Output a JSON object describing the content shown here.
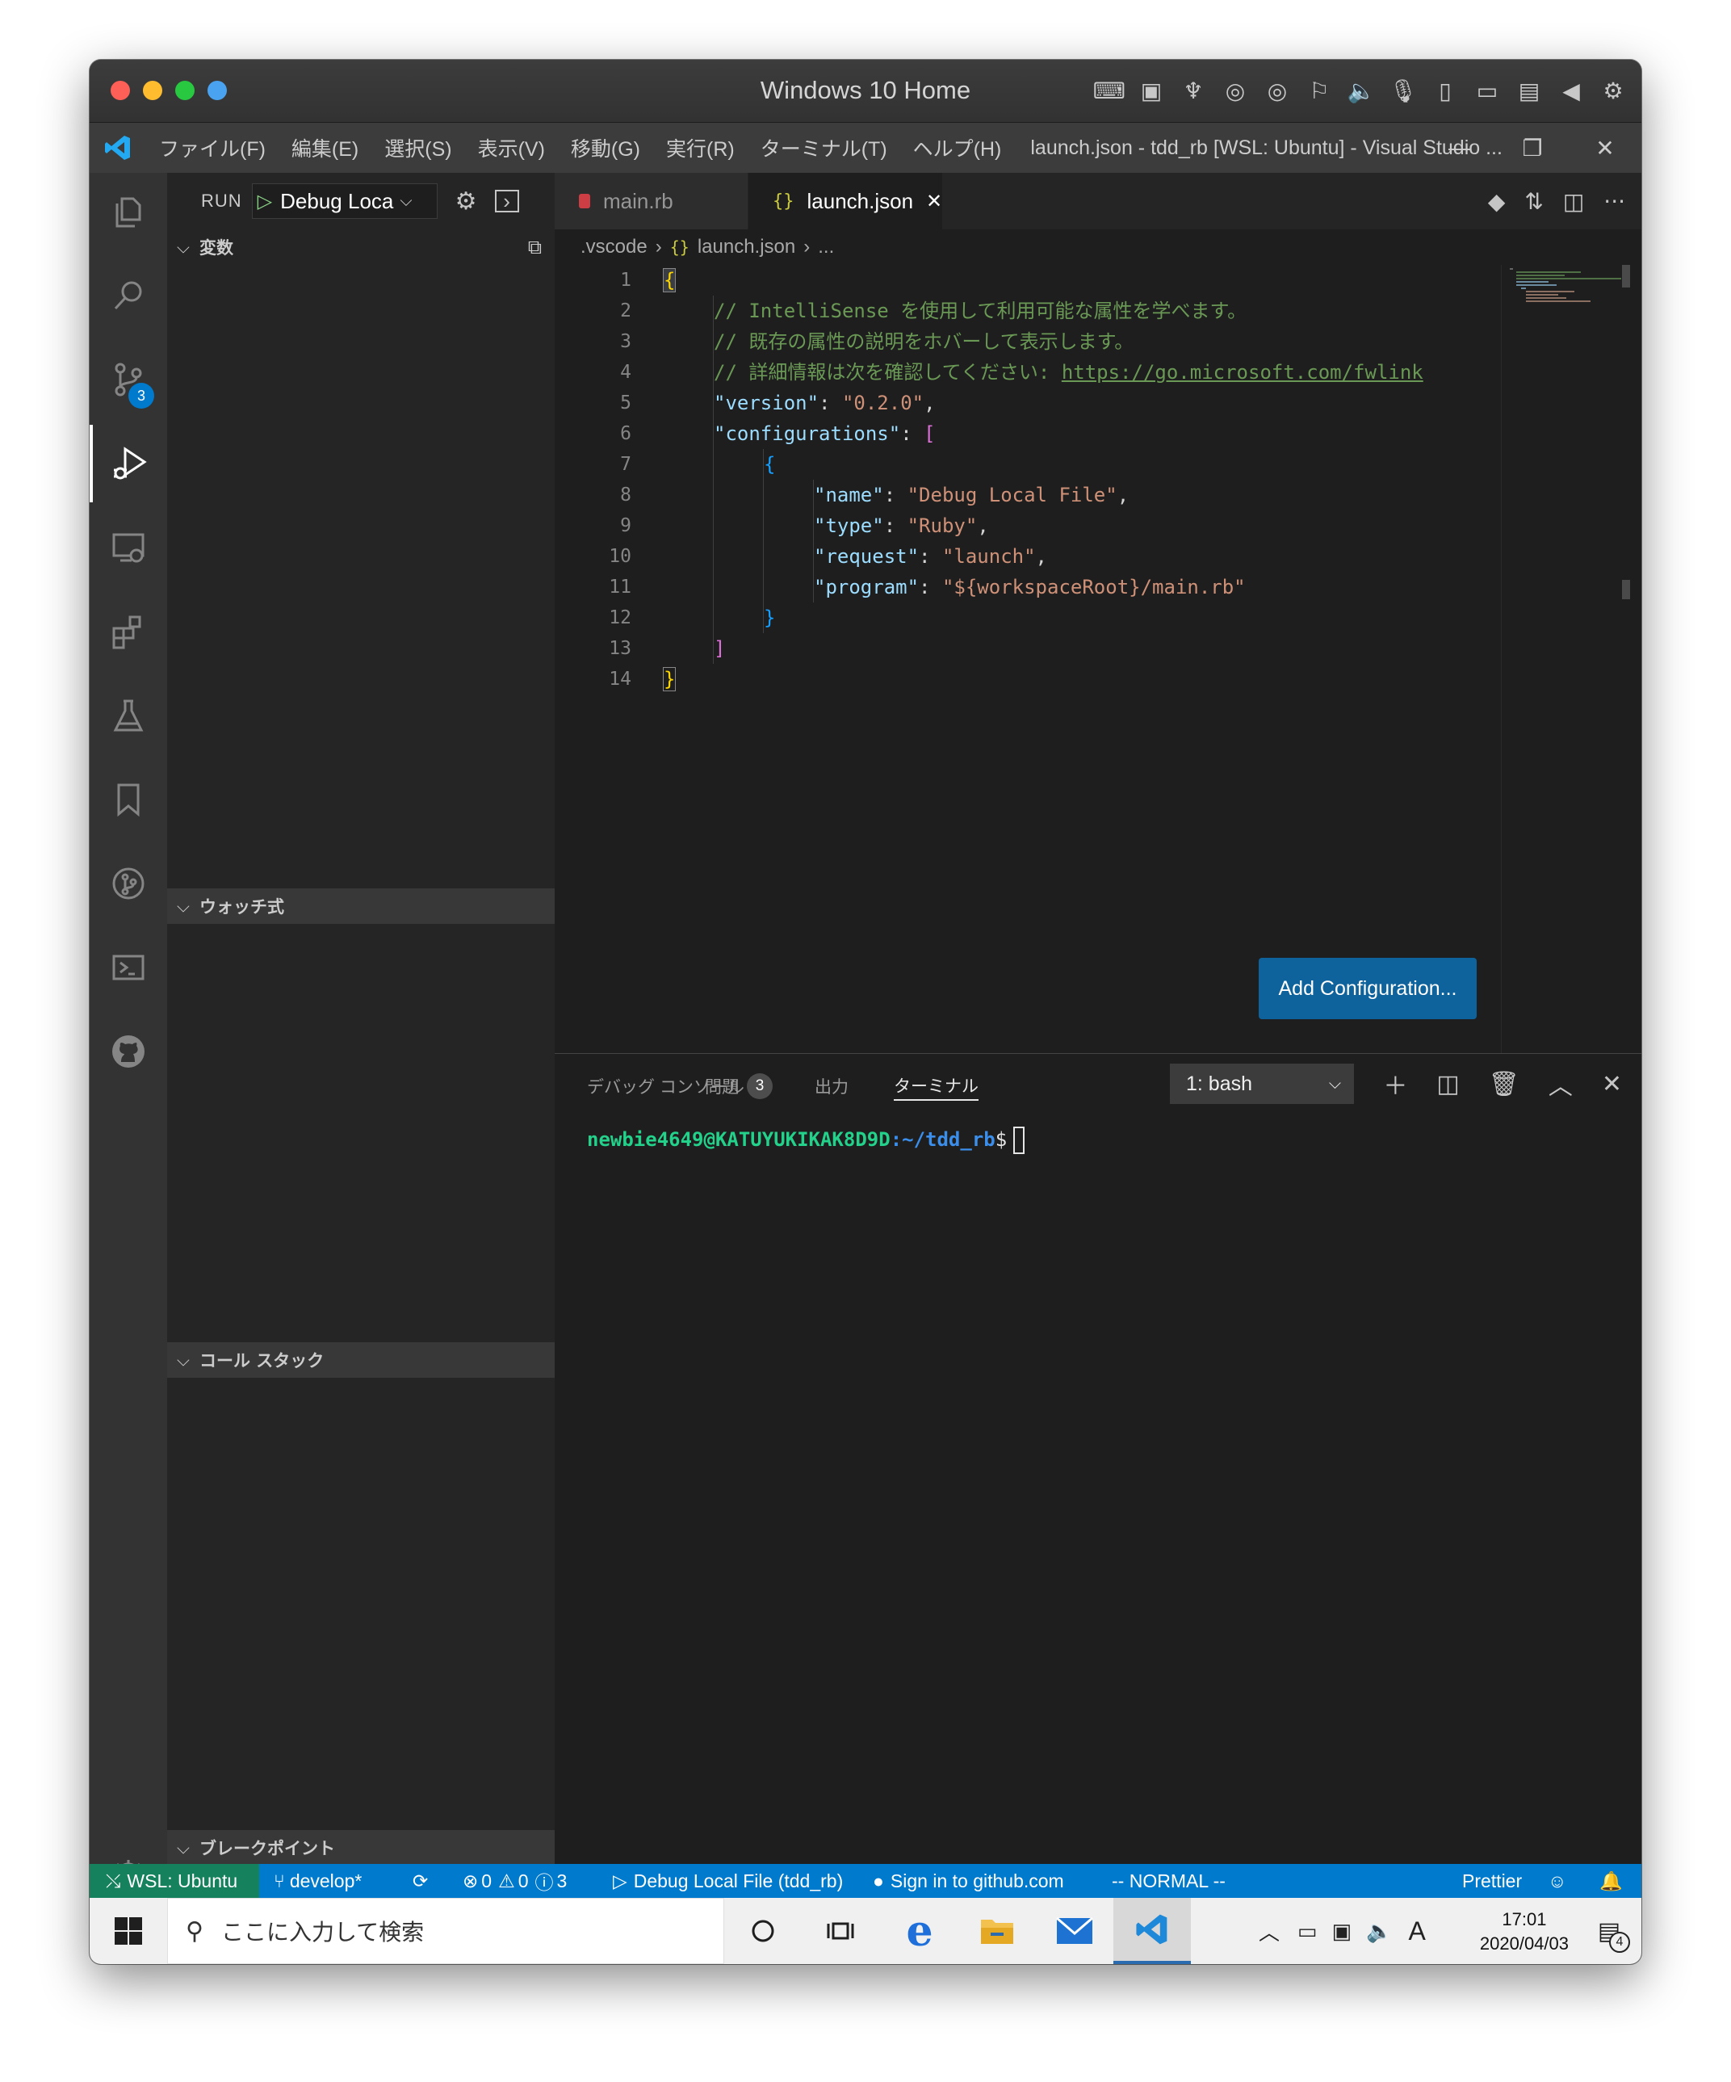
{
  "mac_window": {
    "title": "Windows 10 Home"
  },
  "vscode": {
    "menu": [
      "ファイル(F)",
      "編集(E)",
      "選択(S)",
      "表示(V)",
      "移動(G)",
      "実行(R)",
      "ターミナル(T)",
      "ヘルプ(H)"
    ],
    "window_title": "launch.json - tdd_rb [WSL: Ubuntu] - Visual Studio ...",
    "activity_badge": "3"
  },
  "sidebar": {
    "run_label": "RUN",
    "config_select": "Debug Loca",
    "sections": {
      "variables": "変数",
      "watch": "ウォッチ式",
      "callstack": "コール スタック",
      "breakpoints": "ブレークポイント"
    }
  },
  "tabs": [
    {
      "label": "main.rb"
    },
    {
      "label": "launch.json"
    }
  ],
  "breadcrumb": {
    "folder": ".vscode",
    "file": "launch.json",
    "more": "..."
  },
  "editor": {
    "line_numbers": [
      "1",
      "2",
      "3",
      "4",
      "5",
      "6",
      "7",
      "8",
      "9",
      "10",
      "11",
      "12",
      "13",
      "14"
    ],
    "comments": {
      "c1": "// IntelliSense を使用して利用可能な属性を学べます。",
      "c2": "// 既存の属性の説明をホバーして表示します。",
      "c3": "// 詳細情報は次を確認してください: ",
      "c3_link": "https://go.microsoft.com/fwlink"
    },
    "keys": {
      "version": "\"version\"",
      "configurations": "\"configurations\"",
      "name": "\"name\"",
      "type": "\"type\"",
      "request": "\"request\"",
      "program": "\"program\""
    },
    "values": {
      "version": "\"0.2.0\"",
      "name": "\"Debug Local File\"",
      "type": "\"Ruby\"",
      "request": "\"launch\"",
      "program": "\"${workspaceRoot}/main.rb\""
    },
    "add_configuration": "Add Configuration..."
  },
  "panel": {
    "tabs": [
      "デバッグ コンソール",
      "問題",
      "出力",
      "ターミナル"
    ],
    "problems_badge": "3",
    "terminal_select": "1: bash",
    "prompt": {
      "user": "newbie4649@KATUYUKIKAK8D9D",
      "path": ":~/tdd_rb",
      "dollar": "$"
    }
  },
  "statusbar": {
    "remote": "WSL: Ubuntu",
    "branch": "develop*",
    "errors": "0",
    "warnings": "0",
    "infos": "3",
    "debug": "Debug Local File (tdd_rb)",
    "github": "Sign in to github.com",
    "mode": "-- NORMAL --",
    "prettier": "Prettier"
  },
  "taskbar": {
    "search_placeholder": "ここに入力して検索",
    "ime": "A",
    "time": "17:01",
    "date": "2020/04/03",
    "notifications": "4"
  },
  "colors": {
    "accent": "#007acc",
    "remote": "#16825d",
    "button": "#0e639c"
  }
}
